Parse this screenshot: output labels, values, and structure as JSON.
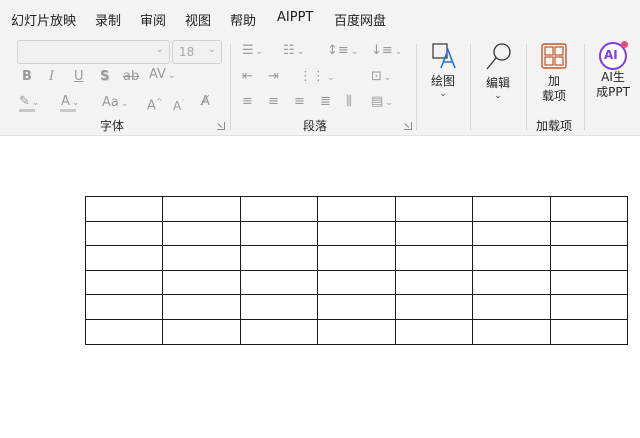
{
  "menu": {
    "items": [
      {
        "label": "幻灯片放映"
      },
      {
        "label": "录制"
      },
      {
        "label": "审阅"
      },
      {
        "label": "视图"
      },
      {
        "label": "帮助"
      },
      {
        "label": "AIPPT"
      },
      {
        "label": "百度网盘"
      }
    ]
  },
  "ribbon": {
    "font": {
      "group_label": "字体",
      "font_name_value": "",
      "font_size_value": "18",
      "bold": "B",
      "italic": "I",
      "underline": "U",
      "shadow": "S",
      "strikethrough": "ab",
      "char_spacing": "AV",
      "font_color": "A",
      "change_case": "Aa",
      "grow_font": "A",
      "shrink_font": "A"
    },
    "paragraph": {
      "group_label": "段落"
    },
    "drawing": {
      "label": "绘图"
    },
    "editing": {
      "label": "编辑"
    },
    "addins": {
      "button_label_1": "加",
      "button_label_2": "载项",
      "group_label": "加载项"
    },
    "aippt": {
      "badge": "AI",
      "label_1": "AI生",
      "label_2": "成PPT",
      "accent_color": "#7b3fe4"
    }
  },
  "slide": {
    "table": {
      "rows": 6,
      "cols": 7
    }
  },
  "colors": {
    "background": "#f3f3f3",
    "addins_accent": "#c4582d"
  }
}
